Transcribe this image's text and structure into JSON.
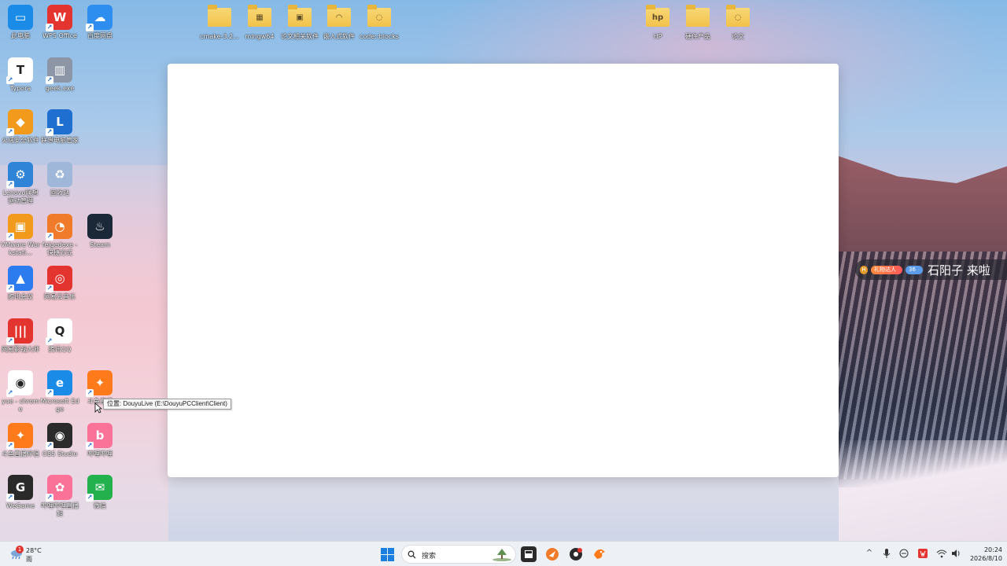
{
  "desktop": {
    "icons_left": [
      {
        "label": "此电脑",
        "color": "#1b8be8",
        "glyph": "▭"
      },
      {
        "label": "WPS Office",
        "color": "#e3342f",
        "glyph": "W"
      },
      {
        "label": "百度网盘",
        "color": "#2e8ef0",
        "glyph": "☁"
      },
      {
        "label": "Typora",
        "color": "#ffffff",
        "glyph": "T"
      },
      {
        "label": "geek.exe",
        "color": "#8c96a6",
        "glyph": "▥"
      },
      {
        "label": "火绒安全软件",
        "color": "#f29a1b",
        "glyph": "◆"
      },
      {
        "label": "联想电脑管家",
        "color": "#1f6fd1",
        "glyph": "L"
      },
      {
        "label": "Lenovo联想驱动管理",
        "color": "#2f84d8",
        "glyph": "⚙"
      },
      {
        "label": "回收站",
        "color": "#9fb7d8",
        "glyph": "♻"
      },
      {
        "label": "VMware Workstati...",
        "color": "#f29a1b",
        "glyph": "▣"
      },
      {
        "label": "feigedexe - 快捷方式",
        "color": "#f07b2a",
        "glyph": "◔"
      },
      {
        "label": "Steam",
        "color": "#1b2838",
        "glyph": "♨"
      },
      {
        "label": "腾讯会议",
        "color": "#2c7cf0",
        "glyph": "▲"
      },
      {
        "label": "网易云音乐",
        "color": "#e3342f",
        "glyph": "◎"
      },
      {
        "label": "网易影视大师",
        "color": "#e3342f",
        "glyph": "|||"
      },
      {
        "label": "腾讯QQ",
        "color": "#ffffff",
        "glyph": "Q"
      },
      {
        "label": "yue - chrome",
        "color": "#ffffff",
        "glyph": "◉"
      },
      {
        "label": "Microsoft Edge",
        "color": "#1b8be8",
        "glyph": "e"
      },
      {
        "label": "斗鱼直播",
        "color": "#ff7a1a",
        "glyph": "✦"
      },
      {
        "label": "斗鱼直播伴侣",
        "color": "#ff7a1a",
        "glyph": "✦"
      },
      {
        "label": "OBS Studio",
        "color": "#2b2b2b",
        "glyph": "◉"
      },
      {
        "label": "哔哩哔哩",
        "color": "#fb7299",
        "glyph": "b"
      },
      {
        "label": "WeGame",
        "color": "#2a2a2a",
        "glyph": "G"
      },
      {
        "label": "哔哩哔哩直播姬",
        "color": "#fb7299",
        "glyph": "✿"
      },
      {
        "label": "微信",
        "color": "#22b14c",
        "glyph": "✉"
      }
    ],
    "folders_top": [
      {
        "label": "cmake-3.2...",
        "glyph": ""
      },
      {
        "label": "mingw64",
        "glyph": "▦"
      },
      {
        "label": "论文相关软件",
        "glyph": "▣"
      },
      {
        "label": "嵌入式软件",
        "glyph": "◠"
      },
      {
        "label": "code::blocks",
        "glyph": "◌"
      },
      {
        "label": "HP",
        "glyph": "hp"
      },
      {
        "label": "硬件产品",
        "glyph": ""
      },
      {
        "label": "论文",
        "glyph": "◌"
      }
    ]
  },
  "tooltip": {
    "text": "位置: DouyuLive (E:\\DouyuPCClient\\Client)"
  },
  "danmaku": {
    "badge_level": "H",
    "badge_fan": "礼物达人",
    "badge_num": "36",
    "message": "石阳子 来啦"
  },
  "taskbar": {
    "weather_temp": "28°C",
    "weather_cond": "雨",
    "notification_count": "1",
    "search_placeholder": "搜索",
    "time": "20:24",
    "date": "2026/8/10"
  }
}
